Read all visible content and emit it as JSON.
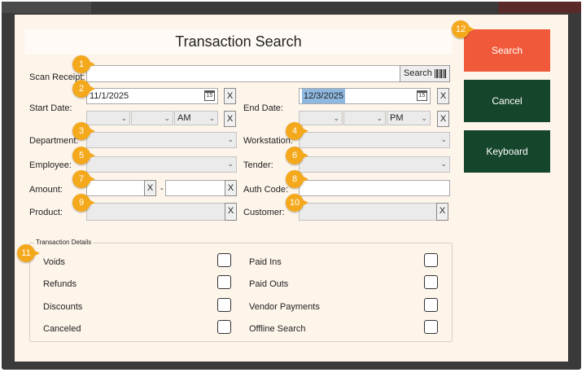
{
  "title": "Transaction Search",
  "scan_receipt": {
    "label": "Scan Receipt:",
    "value": "",
    "search_label": "Search"
  },
  "start_date": {
    "label": "Start Date:",
    "date": "11/1/2025",
    "ampm": "AM"
  },
  "end_date": {
    "label": "End Date:",
    "date": "12/3/2025",
    "ampm": "PM"
  },
  "calendar_glyph": "15",
  "clear_glyph": "X",
  "dash": "-",
  "fields": {
    "department": "Department:",
    "workstation": "Workstation:",
    "employee": "Employee:",
    "tender": "Tender:",
    "amount": "Amount:",
    "auth_code": "Auth Code:",
    "product": "Product:",
    "customer": "Customer:"
  },
  "buttons": {
    "search": "Search",
    "cancel": "Cancel",
    "keyboard": "Keyboard"
  },
  "details": {
    "title": "Transaction Details",
    "left": [
      "Voids",
      "Refunds",
      "Discounts",
      "Canceled"
    ],
    "right": [
      "Paid Ins",
      "Paid Outs",
      "Vendor Payments",
      "Offline Search"
    ]
  },
  "badges": [
    "1",
    "2",
    "3",
    "4",
    "5",
    "6",
    "7",
    "8",
    "9",
    "10",
    "11",
    "12"
  ],
  "colors": {
    "search": "#f05a3a",
    "dark_button": "#15452a",
    "badge": "#f4a81c",
    "background": "#fdf4ea"
  },
  "icons": {
    "barcode": "barcode-icon",
    "calendar": "calendar-icon",
    "chevron": "chevron-down-icon"
  }
}
